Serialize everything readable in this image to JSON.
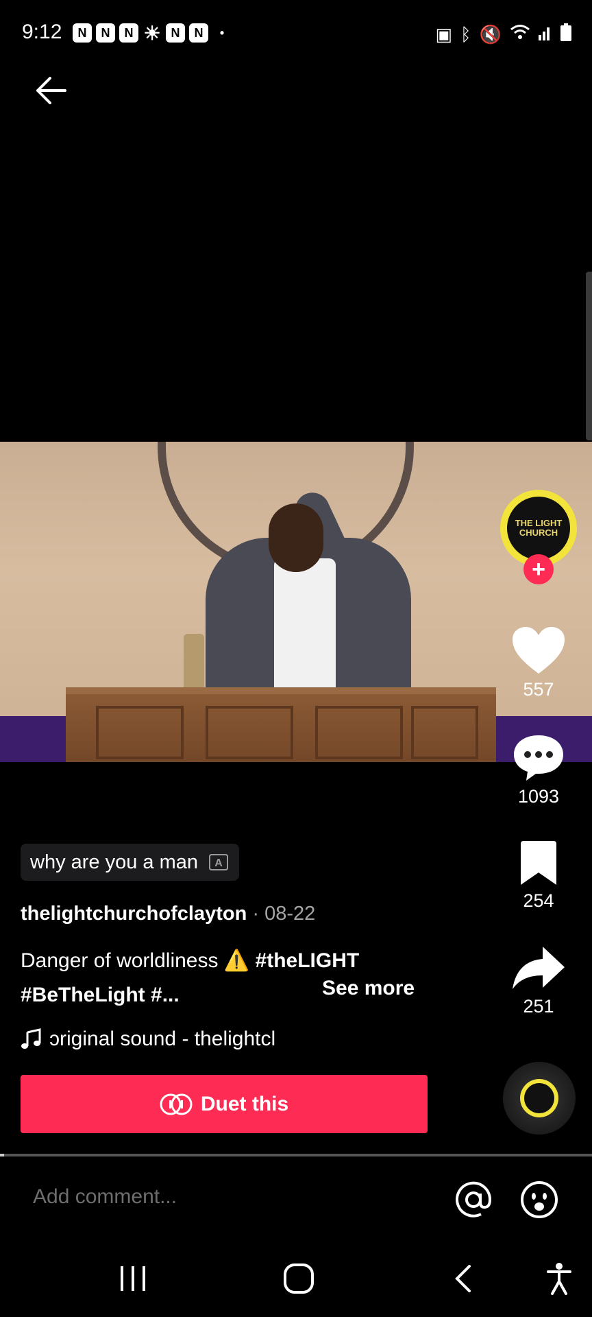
{
  "status_bar": {
    "time": "9:12",
    "notification_icons": [
      "news-icon",
      "news-icon",
      "news-icon",
      "weather-sun-icon",
      "news-icon",
      "news-icon",
      "dot-icon"
    ],
    "system_icons": [
      "nfc-icon",
      "bluetooth-icon",
      "mute-icon",
      "wifi-icon",
      "signal-icon",
      "battery-icon"
    ]
  },
  "header": {
    "back_icon": "arrow-left-icon"
  },
  "video": {
    "progress_fraction": 0.005
  },
  "creator": {
    "avatar_text": "THE LIGHT CHURCH",
    "follow_label": "+"
  },
  "actions": {
    "likes": "557",
    "comments": "1093",
    "saves": "254",
    "shares": "251"
  },
  "search_chip": {
    "text": "why are you a man"
  },
  "post": {
    "author": "thelightchurchofclayton",
    "date": "· 08-22",
    "caption_text": "Danger of worldliness",
    "warning_emoji": "⚠️",
    "hashtag1": "#theLIGHT",
    "hashtag2": "#BeTheLight #...",
    "see_more": "See more",
    "sound": "ɔriginal sound - thelightcl"
  },
  "duet": {
    "label": "Duet this"
  },
  "comment_bar": {
    "placeholder": "Add comment..."
  },
  "colors": {
    "accent": "#fe2c55",
    "avatar_ring": "#f2e43a"
  }
}
